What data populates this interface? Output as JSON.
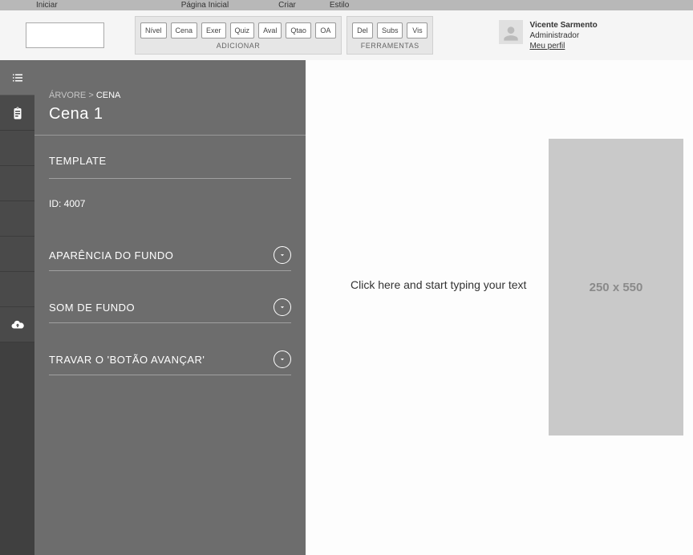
{
  "menubar": {
    "iniciar": "Iniciar",
    "pagina": "Página Inicial",
    "criar": "Criar",
    "estilo": "Estilo"
  },
  "toolbar": {
    "add_label": "ADICIONAR",
    "tools_label": "FERRAMENTAS",
    "add": [
      "Nível",
      "Cena",
      "Exer",
      "Quiz",
      "Aval",
      "Qtao",
      "OA"
    ],
    "tools": [
      "Del",
      "Subs",
      "Vis"
    ]
  },
  "user": {
    "name": "Vicente Sarmento",
    "role": "Administrador",
    "profile": "Meu perfil"
  },
  "panel": {
    "bread_root": "ÁRVORE",
    "bread_sep": " > ",
    "bread_cur": "CENA",
    "title": "Cena 1",
    "template_label": "TEMPLATE",
    "id_label": "ID: ",
    "id_value": "4007",
    "acc1": "APARÊNCIA DO FUNDO",
    "acc2": "SOM DE FUNDO",
    "acc3": "TRAVAR O 'BOTÃO AVANÇAR'"
  },
  "canvas": {
    "text_placeholder": "Click here and start typing your text",
    "image_placeholder": "250 x 550"
  }
}
